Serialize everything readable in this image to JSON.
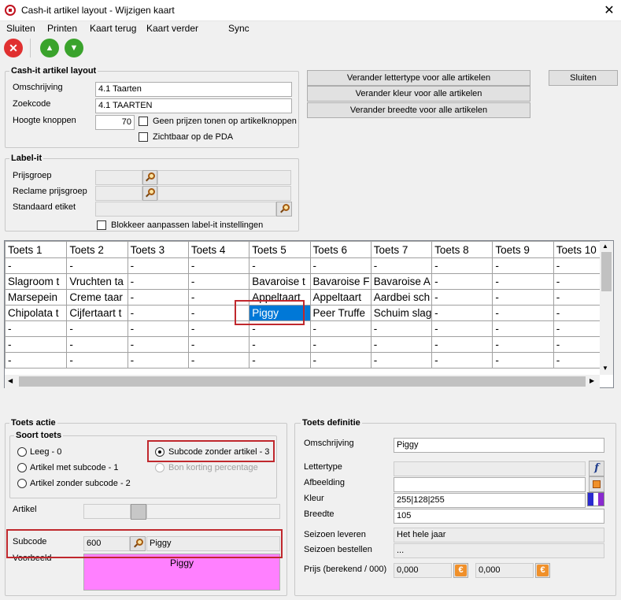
{
  "window": {
    "title": "Cash-it artikel layout - Wijzigen kaart",
    "close_glyph": "✕"
  },
  "menu": {
    "items": [
      "Sluiten",
      "Printen",
      "Kaart terug",
      "Kaart verder",
      "Sync"
    ]
  },
  "toolbar": {
    "icons": [
      "close-red-icon",
      "arrow-up-green-icon",
      "arrow-down-green-icon"
    ],
    "close_glyph": "✕",
    "up_glyph": "▲",
    "down_glyph": "▼"
  },
  "cashit": {
    "title": "Cash-it artikel layout",
    "omschrijving_label": "Omschrijving",
    "omschrijving_value": "4.1 Taarten",
    "zoekcode_label": "Zoekcode",
    "zoekcode_value": "4.1 TAARTEN",
    "hoogte_label": "Hoogte knoppen",
    "hoogte_value": "70",
    "geen_prijzen_label": "Geen prijzen tonen op artikelknoppen",
    "zichtbaar_label": "Zichtbaar op de PDA"
  },
  "actions": {
    "lettertype": "Verander lettertype voor alle artikelen",
    "kleur": "Verander kleur voor alle artikelen",
    "breedte": "Verander breedte voor alle artikelen",
    "sluiten": "Sluiten"
  },
  "labelit": {
    "title": "Label-it",
    "prijsgroep_label": "Prijsgroep",
    "reclame_label": "Reclame prijsgroep",
    "standaard_label": "Standaard etiket",
    "blokkeer_label": "Blokkeer aanpassen label-it instellingen"
  },
  "grid": {
    "headers": [
      "Toets 1",
      "Toets 2",
      "Toets 3",
      "Toets 4",
      "Toets 5",
      "Toets 6",
      "Toets 7",
      "Toets 8",
      "Toets 9",
      "Toets 10"
    ],
    "rows": [
      [
        "-",
        "-",
        "-",
        "-",
        "-",
        "-",
        "-",
        "-",
        "-",
        "-"
      ],
      [
        "Slagroom t",
        "Vruchten ta",
        "-",
        "-",
        "Bavaroise t",
        "Bavaroise F",
        "Bavaroise A",
        "-",
        "-",
        "-"
      ],
      [
        "Marsepein",
        "Creme taar",
        "-",
        "-",
        "Appeltaart",
        "Appeltaart",
        "Aardbei sch",
        "-",
        "-",
        "-"
      ],
      [
        "Chipolata t",
        "Cijfertaart t",
        "-",
        "-",
        "Piggy",
        "Peer Truffe",
        "Schuim slag",
        "-",
        "-",
        "-"
      ],
      [
        "-",
        "-",
        "-",
        "-",
        "-",
        "-",
        "-",
        "-",
        "-",
        "-"
      ],
      [
        "-",
        "-",
        "-",
        "-",
        "-",
        "-",
        "-",
        "-",
        "-",
        "-"
      ],
      [
        "-",
        "-",
        "-",
        "-",
        "-",
        "-",
        "-",
        "-",
        "-",
        "-"
      ]
    ]
  },
  "toets_actie": {
    "title": "Toets actie",
    "soort_title": "Soort toets",
    "leeg": "Leeg - 0",
    "met_subcode": "Artikel met subcode - 1",
    "zonder_subcode": "Artikel zonder subcode - 2",
    "subcode_zonder_artikel": "Subcode zonder artikel - 3",
    "bon_korting": "Bon korting percentage",
    "artikel_label": "Artikel",
    "subcode_label": "Subcode",
    "subcode_value": "600",
    "subcode_name": "Piggy",
    "voorbeeld_label": "Voorbeeld",
    "voorbeeld_text": "Piggy"
  },
  "toets_definitie": {
    "title": "Toets definitie",
    "omschrijving_label": "Omschrijving",
    "omschrijving_value": "Piggy",
    "lettertype_label": "Lettertype",
    "afbeelding_label": "Afbeelding",
    "kleur_label": "Kleur",
    "kleur_value": "255|128|255",
    "breedte_label": "Breedte",
    "breedte_value": "105",
    "seizoen_leveren_label": "Seizoen leveren",
    "seizoen_leveren_value": "Het hele jaar",
    "seizoen_bestellen_label": "Seizoen bestellen",
    "seizoen_bestellen_value": "...",
    "prijs_label": "Prijs (berekend / 000)",
    "prijs1": "0,000",
    "prijs2": "0,000",
    "font_glyph": "f",
    "euro_glyph": "€"
  },
  "colors": {
    "preview_bg": "#ff80ff",
    "selection": "#0078d7",
    "highlight": "#c0282d"
  }
}
